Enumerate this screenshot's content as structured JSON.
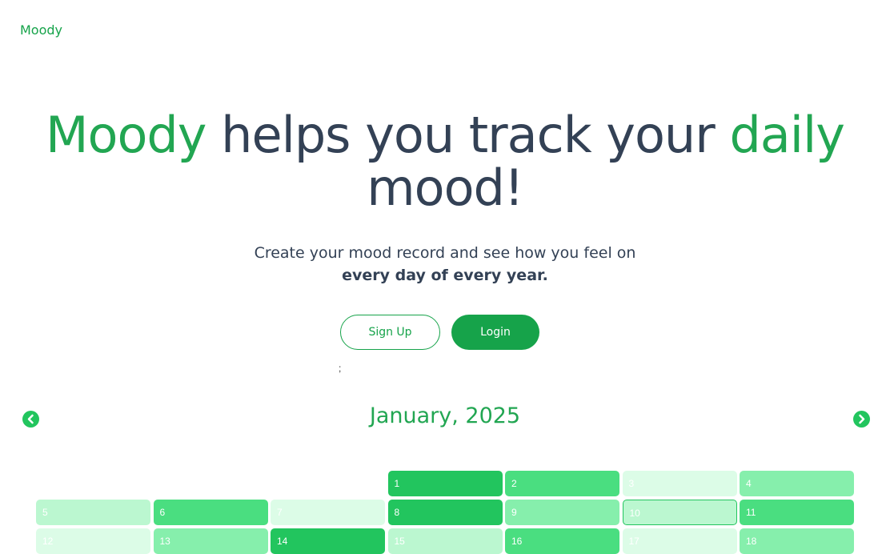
{
  "header": {
    "logo": "Moody"
  },
  "hero": {
    "title_accent_1": "Moody",
    "title_middle": " helps you track your ",
    "title_accent_2": "daily",
    "title_end": "mood!",
    "subtitle_plain": "Create your mood record and see how you feel on ",
    "subtitle_bold": "every day of every year."
  },
  "actions": {
    "signup_label": "Sign Up",
    "login_label": "Login"
  },
  "stray_text": ";",
  "calendar": {
    "month_label": "January, 2025",
    "prev_icon": "chevron-left-icon",
    "next_icon": "chevron-right-icon",
    "leading_blanks": 3,
    "days": [
      {
        "day": "1",
        "mood": 4
      },
      {
        "day": "2",
        "mood": 3
      },
      {
        "day": "3",
        "mood": 0
      },
      {
        "day": "4",
        "mood": 2
      },
      {
        "day": "5",
        "mood": 1
      },
      {
        "day": "6",
        "mood": 3
      },
      {
        "day": "7",
        "mood": 0
      },
      {
        "day": "8",
        "mood": 4
      },
      {
        "day": "9",
        "mood": 2
      },
      {
        "day": "10",
        "mood": 1,
        "today": true
      },
      {
        "day": "11",
        "mood": 3
      },
      {
        "day": "12",
        "mood": 0
      },
      {
        "day": "13",
        "mood": 2
      },
      {
        "day": "14",
        "mood": 4
      },
      {
        "day": "15",
        "mood": 1
      },
      {
        "day": "16",
        "mood": 3
      },
      {
        "day": "17",
        "mood": 0
      },
      {
        "day": "18",
        "mood": 2
      }
    ],
    "mood_colors": [
      "#dcfce7",
      "#bbf7d0",
      "#86efac",
      "#4ade80",
      "#22c55e"
    ]
  }
}
